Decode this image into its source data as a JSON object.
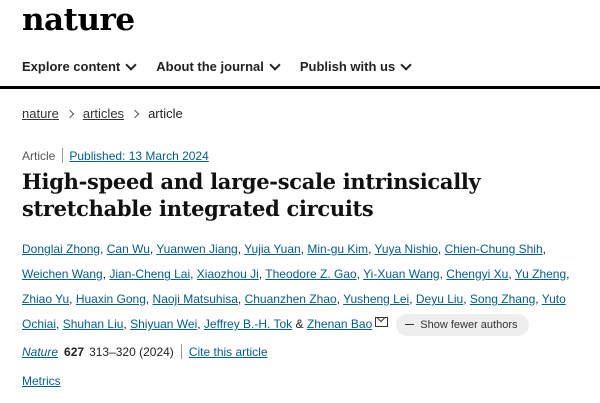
{
  "header": {
    "logo": "nature",
    "nav": [
      {
        "label": "Explore content"
      },
      {
        "label": "About the journal"
      },
      {
        "label": "Publish with us"
      }
    ]
  },
  "breadcrumb": {
    "items": [
      "nature",
      "articles"
    ],
    "current": "article"
  },
  "article": {
    "type": "Article",
    "published": "Published: 13 March 2024",
    "title": "High-speed and large-scale intrinsically stretchable integrated circuits",
    "authors": [
      "Donglai Zhong",
      "Can Wu",
      "Yuanwen Jiang",
      "Yujia Yuan",
      "Min-gu Kim",
      "Yuya Nishio",
      "Chien-Chung Shih",
      "Weichen Wang",
      "Jian-Cheng Lai",
      "Xiaozhou Ji",
      "Theodore Z. Gao",
      "Yi-Xuan Wang",
      "Chengyi Xu",
      "Yu Zheng",
      "Zhiao Yu",
      "Huaxin Gong",
      "Naoji Matsuhisa",
      "Chuanzhen Zhao",
      "Yusheng Lei",
      "Deyu Liu",
      "Song Zhang",
      "Yuto Ochiai",
      "Shuhan Liu",
      "Shiyuan Wei",
      "Jeffrey B.-H. Tok"
    ],
    "and_word": "&",
    "last_author": "Zhenan Bao",
    "show_fewer_label": "Show fewer authors",
    "journal": "Nature",
    "volume": "627",
    "pages_year": "313–320 (2024)",
    "cite_label": "Cite this article",
    "metrics_label": "Metrics"
  }
}
